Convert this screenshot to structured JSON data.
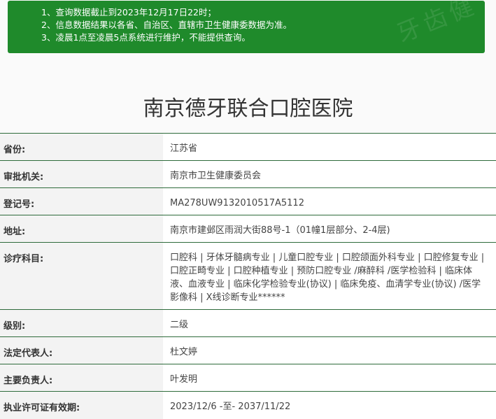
{
  "notice": {
    "lines": [
      "1、查询数据截止到2023年12月17日22时；",
      "2、信息数据结果以各省、自治区、直辖市卫生健康委数据为准。",
      "3、凌晨1点至凌晨5点系统进行维护，不能提供查询。"
    ],
    "bg_color": "#1f8a2b"
  },
  "watermark": "牙齿健",
  "page_title": "南京德牙联合口腔医院",
  "rows": [
    {
      "label": "省份:",
      "value": "江苏省"
    },
    {
      "label": "审批机关:",
      "value": "南京市卫生健康委员会"
    },
    {
      "label": "登记号:",
      "value": "MA278UW9132010517A5112"
    },
    {
      "label": "地址:",
      "value": "南京市建邺区雨润大街88号-1（01幢1层部分、2-4层)"
    },
    {
      "label": "诊疗科目:",
      "value": "口腔科 | 牙体牙髓病专业 | 儿童口腔专业 | 口腔颌面外科专业 | 口腔修复专业 | 口腔正畸专业 | 口腔种植专业 | 预防口腔专业 /麻醉科 /医学检验科 | 临床体液、血液专业 | 临床化学检验专业(协议) | 临床免疫、血清学专业(协议) /医学影像科 | X线诊断专业******"
    },
    {
      "label": "级别:",
      "value": "二级"
    },
    {
      "label": "法定代表人:",
      "value": "杜文婷"
    },
    {
      "label": "主要负责人:",
      "value": "叶发明"
    },
    {
      "label": "执业许可证有效期:",
      "value": "2023/12/6 -至- 2037/11/22"
    }
  ]
}
